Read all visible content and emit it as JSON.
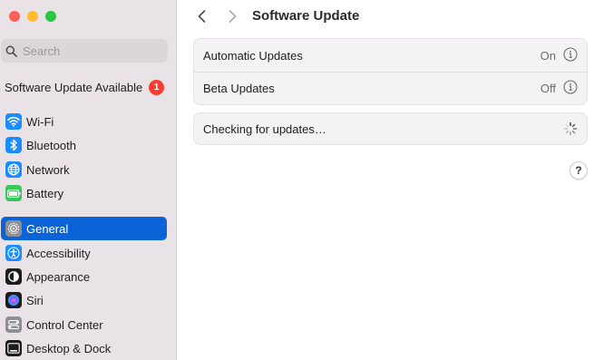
{
  "window": {
    "traffic_lights": [
      "close",
      "minimize",
      "maximize"
    ]
  },
  "sidebar": {
    "search": {
      "placeholder": "Search"
    },
    "update_banner": {
      "label": "Software Update Available",
      "badge_count": "1"
    },
    "items": [
      {
        "label": "Wi-Fi",
        "icon": "wifi-icon",
        "color": "#1a8cff"
      },
      {
        "label": "Bluetooth",
        "icon": "bluetooth-icon",
        "color": "#1a8cff"
      },
      {
        "label": "Network",
        "icon": "globe-icon",
        "color": "#1a8cff"
      },
      {
        "label": "Battery",
        "icon": "battery-icon",
        "color": "#34c759"
      },
      {
        "label": "General",
        "icon": "gear-icon",
        "color": "#8e8e93",
        "selected": true
      },
      {
        "label": "Accessibility",
        "icon": "accessibility-icon",
        "color": "#1a8cff"
      },
      {
        "label": "Appearance",
        "icon": "appearance-icon",
        "color": "#1c1c1e"
      },
      {
        "label": "Siri",
        "icon": "siri-icon",
        "color": "#5e2b97"
      },
      {
        "label": "Control Center",
        "icon": "control-center-icon",
        "color": "#8e8e93"
      },
      {
        "label": "Desktop & Dock",
        "icon": "desktop-dock-icon",
        "color": "#1c1c1e"
      }
    ]
  },
  "toolbar": {
    "title": "Software Update",
    "back_icon": "chevron-left-icon",
    "forward_icon": "chevron-right-icon"
  },
  "main": {
    "settings": [
      {
        "label": "Automatic Updates",
        "value": "On"
      },
      {
        "label": "Beta Updates",
        "value": "Off"
      }
    ],
    "status": {
      "label": "Checking for updates…",
      "icon": "spinner-icon"
    },
    "help_label": "?"
  },
  "colors": {
    "accent": "#0a64d8",
    "badge": "#ff3b30",
    "sidebar_bg": "#e9e3e8"
  }
}
